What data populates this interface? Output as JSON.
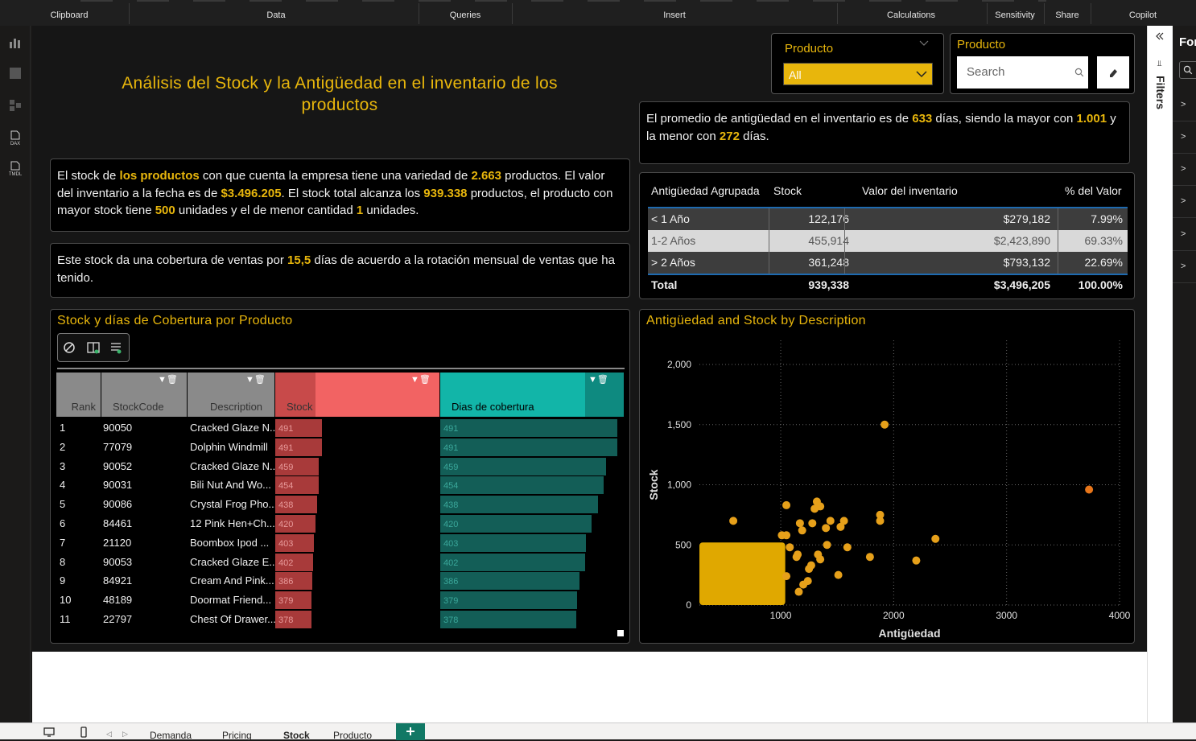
{
  "ribbon": {
    "groups": [
      "Clipboard",
      "Data",
      "Queries",
      "Insert",
      "Calculations",
      "Sensitivity",
      "Share",
      "Copilot"
    ]
  },
  "left_icons": [
    "DAX",
    "TMDL"
  ],
  "title": "Análisis del Stock y la Antigüedad en el inventario de los productos",
  "slicer_dropdown": {
    "header": "Producto",
    "value": "All"
  },
  "slicer_search": {
    "header": "Producto",
    "placeholder": "Search"
  },
  "card_avg": {
    "t1": "El promedio de antigüedad en el inventario es de ",
    "v1": "633",
    "t2": " días, siendo la mayor con ",
    "v2": "1.001",
    "t3": " y la menor con ",
    "v3": "272",
    "t4": " días."
  },
  "card_stock": {
    "t1": "El stock de ",
    "v1": "los productos",
    "t2": " con que cuenta la empresa tiene una variedad de ",
    "v2": "2.663",
    "t3": " productos. El valor del inventario a la fecha es de ",
    "v3": "$3.496.205",
    "t4": ". El stock total alcanza los ",
    "v4": "939.338",
    "t5": " productos, el producto con mayor stock tiene ",
    "v5": "500",
    "t6": " unidades y el de menor cantidad ",
    "v6": "1",
    "t7": " unidades."
  },
  "card_cov": {
    "t1": "Este stock da una cobertura de ventas por ",
    "v1": "15,5",
    "t2": " días de acuerdo a la rotación mensual de ventas que ha tenido."
  },
  "grouped_table": {
    "headers": [
      "Antigüedad Agrupada",
      "Stock",
      "Valor del inventario",
      "% del Valor"
    ],
    "rows": [
      {
        "group": "< 1 Año",
        "stock": "122,176",
        "valor": "$279,182",
        "pct": "7.99%"
      },
      {
        "group": "1-2 Años",
        "stock": "455,914",
        "valor": "$2,423,890",
        "pct": "69.33%"
      },
      {
        "group": "> 2 Años",
        "stock": "361,248",
        "valor": "$793,132",
        "pct": "22.69%"
      }
    ],
    "total": {
      "label": "Total",
      "stock": "939,338",
      "valor": "$3,496,205",
      "pct": "100.00%"
    }
  },
  "matrix": {
    "title": "Stock y días de Cobertura por Producto",
    "headers": [
      "Rank",
      "StockCode",
      "Description",
      "Stock",
      "Dias de cobertura"
    ],
    "max_value": 491,
    "rows": [
      {
        "rank": "1",
        "code": "90050",
        "desc": "Cracked Glaze N...",
        "stock": 491,
        "dias": 491
      },
      {
        "rank": "2",
        "code": "77079",
        "desc": "Dolphin Windmill",
        "stock": 491,
        "dias": 491
      },
      {
        "rank": "3",
        "code": "90052",
        "desc": "Cracked Glaze N...",
        "stock": 459,
        "dias": 459
      },
      {
        "rank": "4",
        "code": "90031",
        "desc": "Bili Nut And Wo...",
        "stock": 454,
        "dias": 454
      },
      {
        "rank": "5",
        "code": "90086",
        "desc": "Crystal Frog Pho...",
        "stock": 438,
        "dias": 438
      },
      {
        "rank": "6",
        "code": "84461",
        "desc": "12 Pink Hen+Ch...",
        "stock": 420,
        "dias": 420
      },
      {
        "rank": "7",
        "code": "21120",
        "desc": "Boombox Ipod ...",
        "stock": 403,
        "dias": 403
      },
      {
        "rank": "8",
        "code": "90053",
        "desc": "Cracked Glaze E...",
        "stock": 402,
        "dias": 402
      },
      {
        "rank": "9",
        "code": "84921",
        "desc": "Cream And Pink...",
        "stock": 386,
        "dias": 386
      },
      {
        "rank": "10",
        "code": "48189",
        "desc": "Doormat Friend...",
        "stock": 379,
        "dias": 379
      },
      {
        "rank": "11",
        "code": "22797",
        "desc": "Chest Of Drawer...",
        "stock": 378,
        "dias": 378
      }
    ]
  },
  "chart_data": {
    "type": "scatter",
    "title": "Antigüedad and Stock by Description",
    "xlabel": "Antigüedad",
    "ylabel": "Stock",
    "xlim": [
      280,
      4000
    ],
    "ylim": [
      0,
      2000
    ],
    "xticks": [
      "1000",
      "2000",
      "3000",
      "4000"
    ],
    "yticks": [
      "0",
      "500",
      "1,000",
      "1,500",
      "2,000"
    ],
    "grid": true,
    "dense_cluster": {
      "x_range": [
        280,
        1040
      ],
      "y_range": [
        0,
        520
      ],
      "color": "#e0a800"
    },
    "points": [
      [
        1920,
        1500
      ],
      [
        3730,
        960
      ],
      [
        1050,
        830
      ],
      [
        1320,
        860
      ],
      [
        1350,
        820
      ],
      [
        1300,
        800
      ],
      [
        580,
        700
      ],
      [
        1170,
        680
      ],
      [
        1280,
        680
      ],
      [
        1440,
        700
      ],
      [
        1560,
        700
      ],
      [
        1530,
        650
      ],
      [
        1400,
        640
      ],
      [
        1880,
        750
      ],
      [
        1880,
        700
      ],
      [
        1050,
        580
      ],
      [
        1010,
        580
      ],
      [
        1190,
        620
      ],
      [
        1080,
        480
      ],
      [
        1590,
        480
      ],
      [
        2370,
        550
      ],
      [
        1410,
        500
      ],
      [
        1330,
        420
      ],
      [
        1150,
        420
      ],
      [
        1140,
        400
      ],
      [
        1350,
        380
      ],
      [
        1790,
        400
      ],
      [
        2200,
        370
      ],
      [
        1270,
        330
      ],
      [
        1510,
        250
      ],
      [
        1050,
        240
      ],
      [
        1250,
        300
      ],
      [
        1240,
        200
      ],
      [
        1200,
        170
      ],
      [
        1160,
        110
      ]
    ],
    "point_color": "#e6a01a",
    "highlight_color": "#e8761a"
  },
  "filters_pane": {
    "label": "Filters"
  },
  "format_pane": {
    "label": "For"
  },
  "page_tabs": [
    "Demanda",
    "Pricing",
    "Stock",
    "Producto"
  ],
  "add_page_icon": "plus-icon"
}
